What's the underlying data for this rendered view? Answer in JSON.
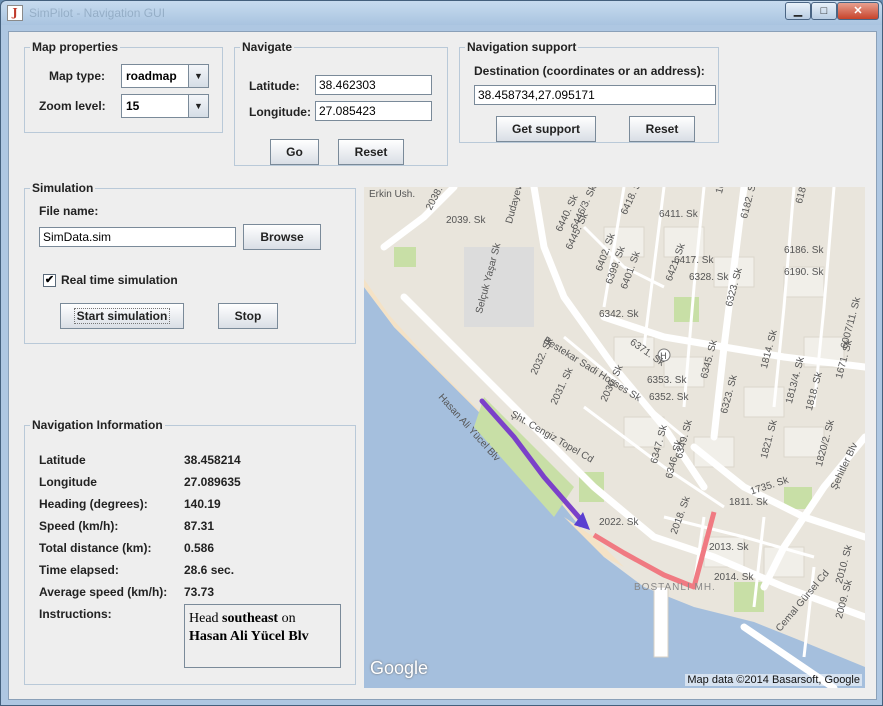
{
  "window": {
    "title": "SimPilot - Navigation GUI"
  },
  "map_properties": {
    "title": "Map properties",
    "map_type_label": "Map type:",
    "map_type_value": "roadmap",
    "zoom_label": "Zoom level:",
    "zoom_value": "15"
  },
  "navigate": {
    "title": "Navigate",
    "latitude_label": "Latitude:",
    "latitude_value": "38.462303",
    "longitude_label": "Longitude:",
    "longitude_value": "27.085423",
    "go_label": "Go",
    "reset_label": "Reset"
  },
  "navigation_support": {
    "title": "Navigation support",
    "destination_label": "Destination (coordinates or an address):",
    "destination_value": "38.458734,27.095171",
    "get_support_label": "Get support",
    "reset_label": "Reset"
  },
  "simulation": {
    "title": "Simulation",
    "file_name_label": "File name:",
    "file_name_value": "SimData.sim",
    "browse_label": "Browse",
    "realtime_label": "Real time simulation",
    "realtime_checked": true,
    "start_label": "Start simulation",
    "stop_label": "Stop"
  },
  "navigation_info": {
    "title": "Navigation Information",
    "rows": [
      {
        "label": "Latitude",
        "value": "38.458214"
      },
      {
        "label": "Longitude",
        "value": "27.089635"
      },
      {
        "label": "Heading (degrees):",
        "value": "140.19"
      },
      {
        "label": "Speed (km/h):",
        "value": "87.31"
      },
      {
        "label": "Total distance (km):",
        "value": "0.586"
      },
      {
        "label": "Time elapsed:",
        "value": "28.6 sec."
      },
      {
        "label": "Average speed (km/h):",
        "value": "73.73"
      }
    ],
    "instructions_label": "Instructions:",
    "instructions": {
      "prefix": "Head ",
      "direction": "southeast",
      "suffix": " on",
      "street": "Hasan Ali Yücel Blv"
    }
  },
  "map": {
    "street_labels": [
      "Erkin Ush.",
      "2038. Sk",
      "2039. Sk",
      "Dudayev Blv",
      "6440. Sk",
      "6446/3. Sk",
      "6445. Sk",
      "6418. Sk",
      "6411. Sk",
      "1671. Sk",
      "6182. Sk",
      "6180/1. Sk",
      "6186. Sk",
      "6190. Sk",
      "6417. Sk",
      "6328. Sk",
      "6323. Sk",
      "6402. Sk",
      "6399. Sk",
      "6401. Sk",
      "6342. Sk",
      "6421. Sk",
      "Selçuk Yaşar Sk",
      "Bestekar Sadi Hoşses Sk",
      "6371. Sk",
      "Hasan Ali Yücel Blv",
      "2032. Sk",
      "2031. Sk",
      "2030. Sk",
      "Şht. Cengiz Topel Cd",
      "6353. Sk",
      "6352. Sk",
      "6345. Sk",
      "6323. Sk",
      "1814. Sk",
      "1813/4. Sk",
      "1818. Sk",
      "1821. Sk",
      "1820/2. Sk",
      "Şehitler Blv",
      "1735. Sk",
      "1811. Sk",
      "6347. Sk",
      "6346. Sk",
      "6349. Sk",
      "2022. Sk",
      "2018. Sk",
      "2013. Sk",
      "2014. Sk",
      "BOSTANLI MH.",
      "Cemal Gürsel Cd",
      "2010. Sk",
      "2009. Sk",
      "6007/11. Sk",
      "1671. Sk"
    ],
    "google_label": "Google",
    "attribution": "Map data ©2014 Basarsoft, Google"
  }
}
